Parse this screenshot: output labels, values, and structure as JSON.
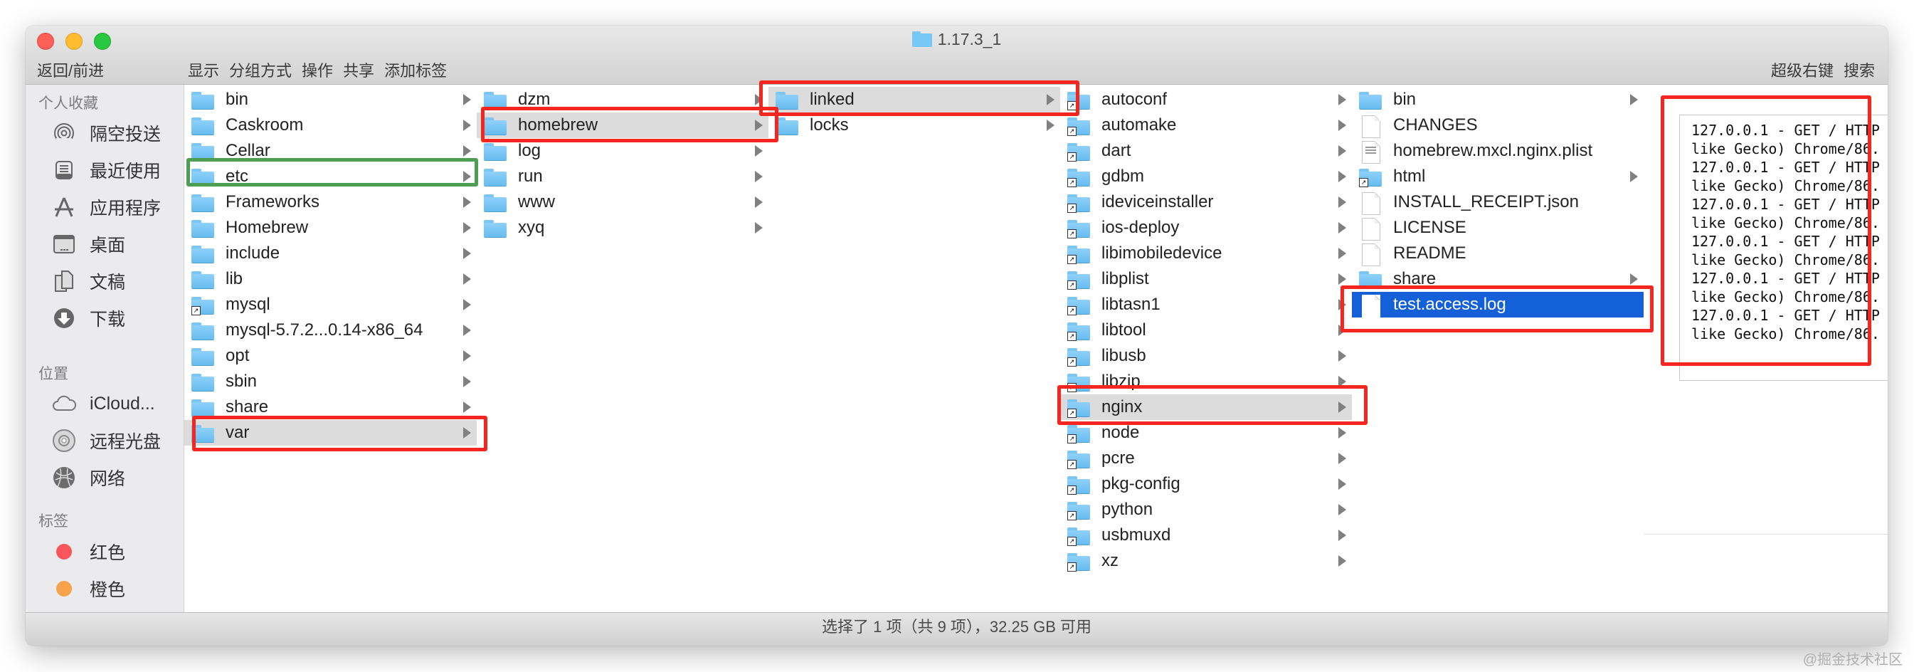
{
  "window": {
    "title": "1.17.3_1",
    "title_icon": "folder-icon"
  },
  "toolbar": {
    "back_forward": "返回/前进",
    "left_items": [
      "显示",
      "分组方式",
      "操作",
      "共享",
      "添加标签"
    ],
    "right_items": [
      "超级右键",
      "搜索"
    ]
  },
  "sidebar": {
    "favorites_header": "个人收藏",
    "favorites": [
      {
        "label": "隔空投送",
        "icon": "airdrop-icon"
      },
      {
        "label": "最近使用",
        "icon": "recents-icon"
      },
      {
        "label": "应用程序",
        "icon": "applications-icon"
      },
      {
        "label": "桌面",
        "icon": "desktop-icon"
      },
      {
        "label": "文稿",
        "icon": "documents-icon"
      },
      {
        "label": "下载",
        "icon": "downloads-icon"
      }
    ],
    "locations_header": "位置",
    "locations": [
      {
        "label": "iCloud...",
        "icon": "icloud-icon"
      },
      {
        "label": "远程光盘",
        "icon": "remote-disc-icon"
      },
      {
        "label": "网络",
        "icon": "network-icon"
      }
    ],
    "tags_header": "标签",
    "tags": [
      {
        "label": "红色",
        "color": "#f8565b"
      },
      {
        "label": "橙色",
        "color": "#f5a24a"
      }
    ]
  },
  "columns": [
    {
      "items": [
        {
          "name": "bin",
          "type": "folder"
        },
        {
          "name": "Caskroom",
          "type": "folder"
        },
        {
          "name": "Cellar",
          "type": "folder"
        },
        {
          "name": "etc",
          "type": "folder"
        },
        {
          "name": "Frameworks",
          "type": "folder"
        },
        {
          "name": "Homebrew",
          "type": "folder"
        },
        {
          "name": "include",
          "type": "folder"
        },
        {
          "name": "lib",
          "type": "folder"
        },
        {
          "name": "mysql",
          "type": "folder-alias"
        },
        {
          "name": "mysql-5.7.2...0.14-x86_64",
          "type": "folder"
        },
        {
          "name": "opt",
          "type": "folder"
        },
        {
          "name": "sbin",
          "type": "folder"
        },
        {
          "name": "share",
          "type": "folder"
        },
        {
          "name": "var",
          "type": "folder",
          "state": "path-selected"
        }
      ]
    },
    {
      "items": [
        {
          "name": "dzm",
          "type": "folder"
        },
        {
          "name": "homebrew",
          "type": "folder",
          "state": "path-selected"
        },
        {
          "name": "log",
          "type": "folder"
        },
        {
          "name": "run",
          "type": "folder"
        },
        {
          "name": "www",
          "type": "folder"
        },
        {
          "name": "xyq",
          "type": "folder"
        }
      ]
    },
    {
      "items": [
        {
          "name": "linked",
          "type": "folder",
          "state": "path-selected"
        },
        {
          "name": "locks",
          "type": "folder"
        }
      ]
    },
    {
      "items": [
        {
          "name": "autoconf",
          "type": "folder-alias"
        },
        {
          "name": "automake",
          "type": "folder-alias"
        },
        {
          "name": "dart",
          "type": "folder-alias"
        },
        {
          "name": "gdbm",
          "type": "folder-alias"
        },
        {
          "name": "ideviceinstaller",
          "type": "folder-alias"
        },
        {
          "name": "ios-deploy",
          "type": "folder-alias"
        },
        {
          "name": "libimobiledevice",
          "type": "folder-alias"
        },
        {
          "name": "libplist",
          "type": "folder-alias"
        },
        {
          "name": "libtasn1",
          "type": "folder-alias"
        },
        {
          "name": "libtool",
          "type": "folder-alias"
        },
        {
          "name": "libusb",
          "type": "folder-alias"
        },
        {
          "name": "libzip",
          "type": "folder-alias"
        },
        {
          "name": "nginx",
          "type": "folder-alias",
          "state": "path-selected"
        },
        {
          "name": "node",
          "type": "folder-alias"
        },
        {
          "name": "pcre",
          "type": "folder-alias"
        },
        {
          "name": "pkg-config",
          "type": "folder-alias"
        },
        {
          "name": "python",
          "type": "folder-alias"
        },
        {
          "name": "usbmuxd",
          "type": "folder-alias"
        },
        {
          "name": "xz",
          "type": "folder-alias"
        }
      ]
    },
    {
      "items": [
        {
          "name": "bin",
          "type": "folder"
        },
        {
          "name": "CHANGES",
          "type": "file"
        },
        {
          "name": "homebrew.mxcl.nginx.plist",
          "type": "plist"
        },
        {
          "name": "html",
          "type": "folder-alias"
        },
        {
          "name": "INSTALL_RECEIPT.json",
          "type": "file"
        },
        {
          "name": "LICENSE",
          "type": "file"
        },
        {
          "name": "README",
          "type": "file"
        },
        {
          "name": "share",
          "type": "folder"
        },
        {
          "name": "test.access.log",
          "type": "file",
          "state": "selected"
        }
      ]
    }
  ],
  "preview": {
    "lines": [
      "127.0.0.1 - GET / HTTP",
      "like Gecko) Chrome/86.",
      "127.0.0.1 - GET / HTTP",
      "like Gecko) Chrome/86.",
      "127.0.0.1 - GET / HTTP",
      "like Gecko) Chrome/86.",
      "127.0.0.1 - GET / HTTP",
      "like Gecko) Chrome/86.",
      "127.0.0.1 - GET / HTTP",
      "like Gecko) Chrome/86.",
      "127.0.0.1 - GET / HTTP",
      "like Gecko) Chrome/86."
    ]
  },
  "status_bar": {
    "text": "选择了 1 项（共 9 项），32.25 GB 可用"
  },
  "annotations": {
    "highlight_red": "#f5251f",
    "highlight_green": "#4d9e52"
  },
  "watermark": "@掘金技术社区"
}
